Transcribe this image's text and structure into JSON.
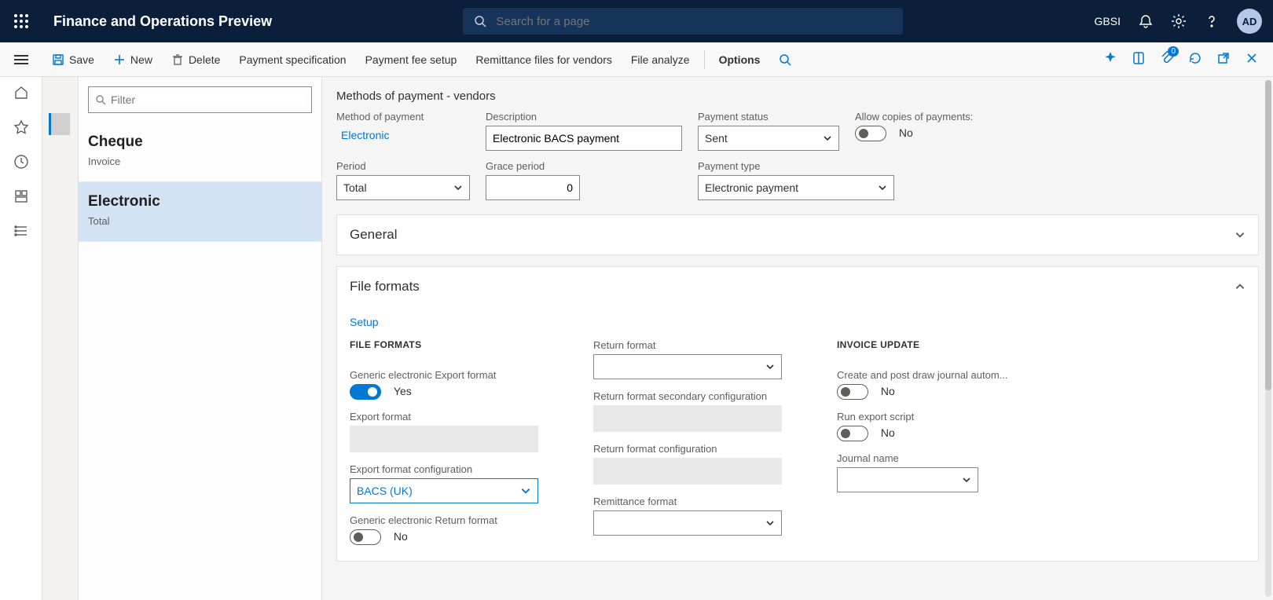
{
  "top": {
    "app_title": "Finance and Operations Preview",
    "search_placeholder": "Search for a page",
    "org": "GBSI",
    "avatar": "AD"
  },
  "action": {
    "save": "Save",
    "new": "New",
    "delete": "Delete",
    "payment_spec": "Payment specification",
    "payment_fee": "Payment fee setup",
    "remittance": "Remittance files for vendors",
    "file_analyze": "File analyze",
    "options": "Options"
  },
  "filter": {
    "placeholder": "Filter"
  },
  "list": [
    {
      "title": "Cheque",
      "sub": "Invoice"
    },
    {
      "title": "Electronic",
      "sub": "Total"
    }
  ],
  "page": {
    "breadcrumb": "Methods of payment - vendors",
    "method_of_payment_label": "Method of payment",
    "method_of_payment_value": "Electronic",
    "description_label": "Description",
    "description_value": "Electronic BACS payment",
    "payment_status_label": "Payment status",
    "payment_status_value": "Sent",
    "allow_copies_label": "Allow copies of payments:",
    "allow_copies_value": "No",
    "period_label": "Period",
    "period_value": "Total",
    "grace_label": "Grace period",
    "grace_value": "0",
    "payment_type_label": "Payment type",
    "payment_type_value": "Electronic payment"
  },
  "cards": {
    "general": "General",
    "file_formats": "File formats"
  },
  "ff": {
    "setup": "Setup",
    "h1": "FILE FORMATS",
    "generic_export_label": "Generic electronic Export format",
    "generic_export_value": "Yes",
    "export_format_label": "Export format",
    "export_config_label": "Export format configuration",
    "export_config_value": "BACS (UK)",
    "generic_return_label": "Generic electronic Return format",
    "generic_return_value": "No",
    "return_format_label": "Return format",
    "return_secondary_label": "Return format secondary configuration",
    "return_config_label": "Return format configuration",
    "remittance_format_label": "Remittance format",
    "h2": "INVOICE UPDATE",
    "create_post_label": "Create and post draw journal autom...",
    "create_post_value": "No",
    "run_export_label": "Run export script",
    "run_export_value": "No",
    "journal_label": "Journal name"
  }
}
